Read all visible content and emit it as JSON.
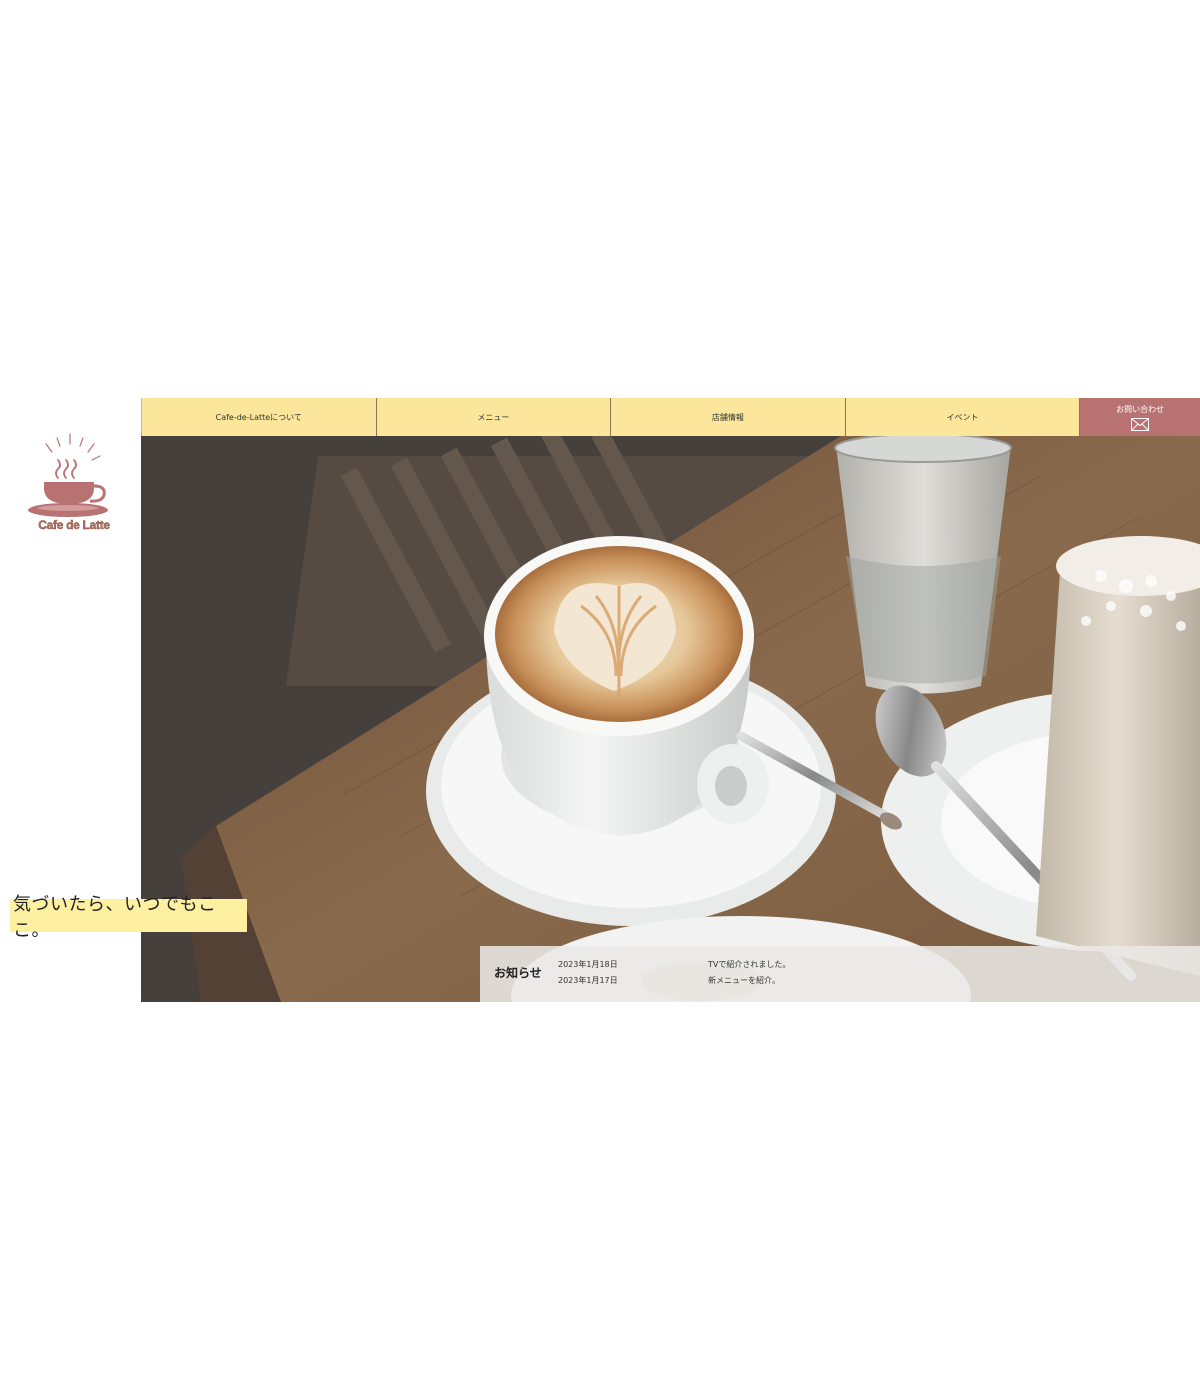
{
  "logo": {
    "text": "Cafe de Latte",
    "icon": "coffee-cup-logo",
    "color": "#b97272"
  },
  "nav": {
    "items": [
      {
        "label": "Cafe-de-Latteについて"
      },
      {
        "label": "メニュー"
      },
      {
        "label": "店舗情報"
      },
      {
        "label": "イベント"
      }
    ],
    "contact": {
      "label": "お問い合わせ",
      "icon": "mail-icon"
    },
    "colors": {
      "item_bg": "#fbe69c",
      "contact_bg": "#b97272"
    }
  },
  "hero": {
    "image": "latte-art-coffee-photo"
  },
  "tagline": {
    "text": "気づいたら、いつでもここ。",
    "bg": "#fdf0a0"
  },
  "news": {
    "title": "お知らせ",
    "items": [
      {
        "date": "2023年1月18日",
        "text": "TVで紹介されました。"
      },
      {
        "date": "2023年1月17日",
        "text": "新メニューを紹介。"
      }
    ]
  }
}
